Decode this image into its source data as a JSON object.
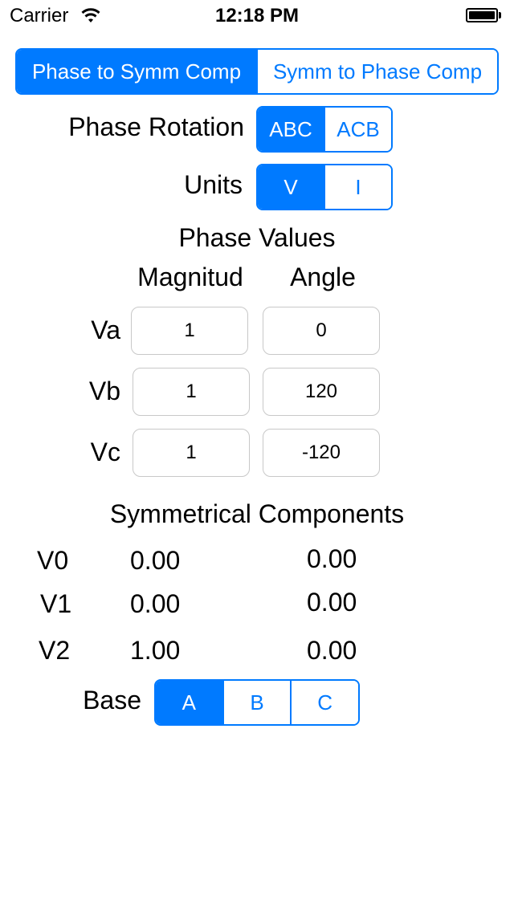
{
  "status_bar": {
    "carrier": "Carrier",
    "time": "12:18 PM"
  },
  "mode_tabs": {
    "items": [
      "Phase to Symm Comp",
      "Symm to Phase Comp"
    ],
    "selected": 0
  },
  "phase_rotation": {
    "label": "Phase Rotation",
    "options": [
      "ABC",
      "ACB"
    ],
    "selected": 0
  },
  "units": {
    "label": "Units",
    "options": [
      "V",
      "I"
    ],
    "selected": 0
  },
  "phase_values": {
    "title": "Phase Values",
    "col_magnitude": "Magnitud",
    "col_angle": "Angle",
    "rows": [
      {
        "label": "Va",
        "magnitude": "1",
        "angle": "0"
      },
      {
        "label": "Vb",
        "magnitude": "1",
        "angle": "120"
      },
      {
        "label": "Vc",
        "magnitude": "1",
        "angle": "-120"
      }
    ]
  },
  "symmetrical_components": {
    "title": "Symmetrical Components",
    "rows": [
      {
        "label": "V0",
        "magnitude": "0.00",
        "angle": "0.00"
      },
      {
        "label": "V1",
        "magnitude": "0.00",
        "angle": "0.00"
      },
      {
        "label": "V2",
        "magnitude": "1.00",
        "angle": "0.00"
      }
    ]
  },
  "base": {
    "label": "Base",
    "options": [
      "A",
      "B",
      "C"
    ],
    "selected": 0
  },
  "colors": {
    "accent": "#007aff",
    "field_border": "#c8c8c8"
  }
}
